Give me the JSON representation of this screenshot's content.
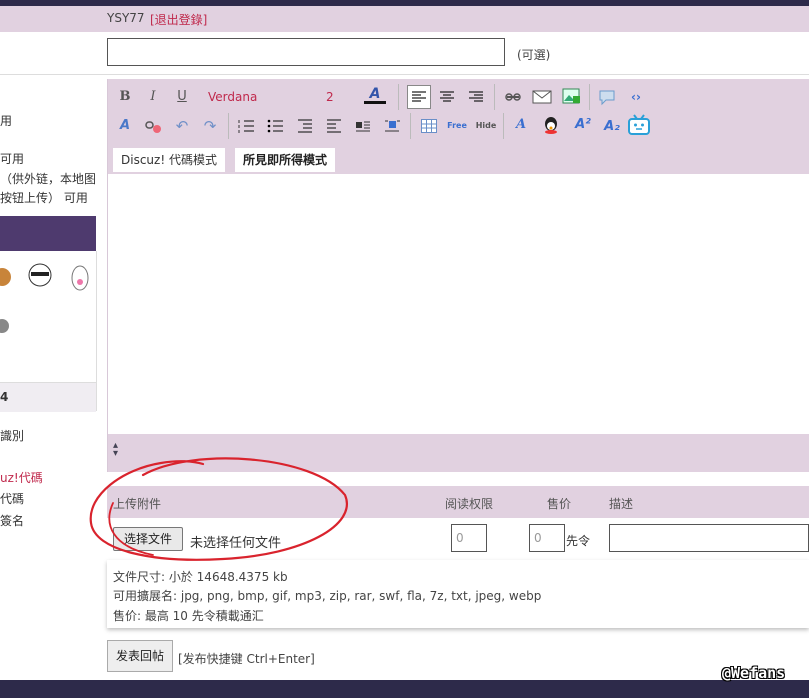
{
  "user": {
    "name": "YSY77",
    "logout": "[退出登錄]"
  },
  "subject": {
    "value": "",
    "optional_label": "(可選)"
  },
  "left_fragments": [
    "用",
    "可用",
    "（供外链，本地图",
    "按钮上传） 可用",
    "4",
    "識別",
    "uz!代碼",
    "代碼",
    "簽名"
  ],
  "toolbar": {
    "font_name": "Verdana",
    "font_size": "2",
    "row1_icons": [
      "bold-icon",
      "italic-icon",
      "underline-icon",
      "font-color-icon",
      "align-left-icon",
      "align-center-icon",
      "align-right-icon",
      "link-icon",
      "email-icon",
      "image-icon",
      "quote-icon",
      "code-icon"
    ],
    "row2_icons": [
      "remove-format-icon",
      "unlink-icon",
      "undo-icon",
      "redo-icon",
      "ordered-list-icon",
      "unordered-list-icon",
      "outdent-icon",
      "indent-icon",
      "float-left-icon",
      "float-right-icon",
      "table-icon",
      "free-icon",
      "hide-icon",
      "font-icon",
      "qq-icon",
      "superscript-icon",
      "subscript-icon",
      "tv-icon"
    ],
    "free_label": "Free",
    "hide_label": "Hide"
  },
  "editor": {
    "tabs": [
      {
        "label": "Discuz! 代碼模式"
      },
      {
        "label": "所見即所得模式"
      }
    ]
  },
  "attachment": {
    "header_upload": "上传附件",
    "header_permission": "阅读权限",
    "header_price": "售价",
    "header_desc": "描述",
    "choose_button": "选择文件",
    "no_file": "未选择任何文件",
    "permission_value": "0",
    "price_value": "0",
    "currency": "先令",
    "desc_value": "",
    "info": [
      "文件尺寸: 小於 14648.4375 kb",
      "可用擴展名: jpg, png, bmp, gif, mp3, zip, rar, swf, fla, 7z, txt, jpeg, webp",
      "售价: 最高 10 先令積載通汇"
    ]
  },
  "footer": {
    "submit": "发表回帖",
    "hint": "[发布快捷键 Ctrl+Enter]"
  },
  "watermark": "@Wefans",
  "colors": {
    "accent": "#c0294c",
    "toolbar_bg": "#e1d1e0",
    "header_bar": "#2d2a4a",
    "annotation": "#d9232d"
  }
}
